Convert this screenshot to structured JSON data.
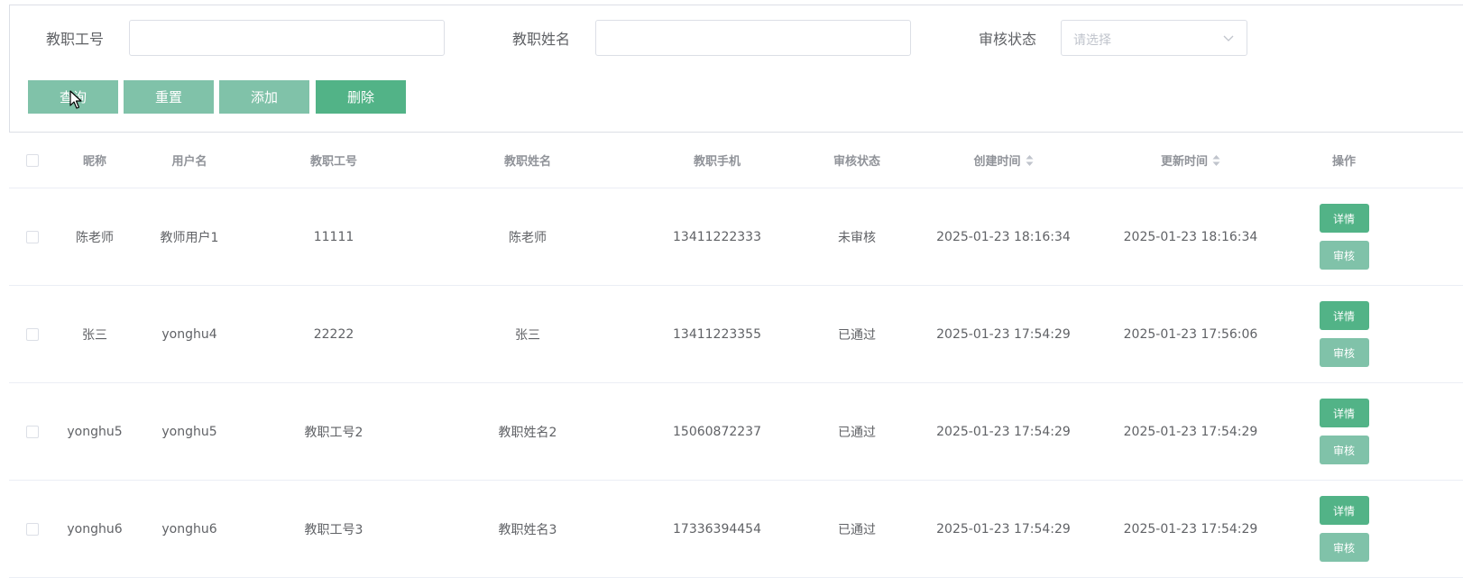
{
  "search": {
    "teacher_id_label": "教职工号",
    "teacher_id_value": "",
    "teacher_name_label": "教职姓名",
    "teacher_name_value": "",
    "status_label": "审核状态",
    "status_placeholder": "请选择"
  },
  "actions": {
    "query": "查询",
    "reset": "重置",
    "add": "添加",
    "delete": "删除"
  },
  "table": {
    "columns": [
      "昵称",
      "用户名",
      "教职工号",
      "教职姓名",
      "教职手机",
      "审核状态",
      "创建时间",
      "更新时间",
      "操作"
    ],
    "rows": [
      {
        "nickname": "陈老师",
        "username": "教师用户1",
        "teacher_id": "11111",
        "teacher_name": "陈老师",
        "phone": "13411222333",
        "status": "未审核",
        "created": "2025-01-23 18:16:34",
        "updated": "2025-01-23 18:16:34"
      },
      {
        "nickname": "张三",
        "username": "yonghu4",
        "teacher_id": "22222",
        "teacher_name": "张三",
        "phone": "13411223355",
        "status": "已通过",
        "created": "2025-01-23 17:54:29",
        "updated": "2025-01-23 17:56:06"
      },
      {
        "nickname": "yonghu5",
        "username": "yonghu5",
        "teacher_id": "教职工号2",
        "teacher_name": "教职姓名2",
        "phone": "15060872237",
        "status": "已通过",
        "created": "2025-01-23 17:54:29",
        "updated": "2025-01-23 17:54:29"
      },
      {
        "nickname": "yonghu6",
        "username": "yonghu6",
        "teacher_id": "教职工号3",
        "teacher_name": "教职姓名3",
        "phone": "17336394454",
        "status": "已通过",
        "created": "2025-01-23 17:54:29",
        "updated": "2025-01-23 17:54:29"
      }
    ],
    "row_actions": {
      "detail": "详情",
      "audit": "审核"
    }
  },
  "colors": {
    "primary": "#52b387",
    "primary_light": "#80c2a9",
    "border": "#dcdfe6",
    "text": "#606266",
    "header_text": "#909399"
  },
  "icons": {
    "select_arrow": "chevron-down-icon",
    "sort": "sort-icon",
    "cursor": "cursor-icon"
  }
}
